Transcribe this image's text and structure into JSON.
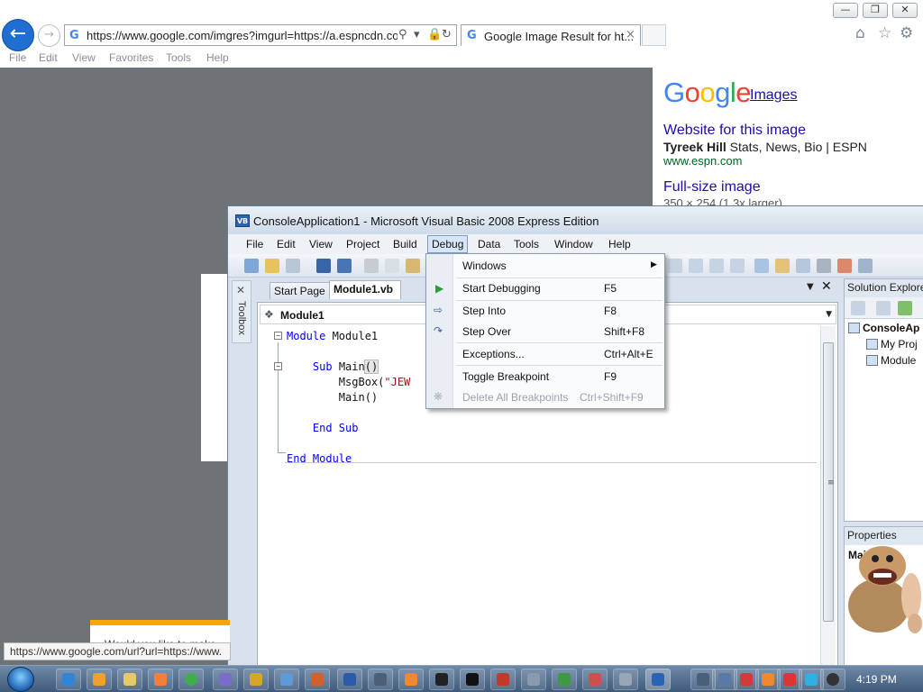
{
  "browser": {
    "address_url": "https://www.google.com/imgres?imgurl=https://a.espncdn.con",
    "tab_title": "Google Image Result for ht...",
    "tab_close": "×",
    "menu": [
      "File",
      "Edit",
      "View",
      "Favorites",
      "Tools",
      "Help"
    ],
    "status_url": "https://www.google.com/url?url=https://www.",
    "window_controls": {
      "minimize": "—",
      "restore": "❐",
      "close": "✕"
    }
  },
  "page": {
    "logo_text": "Google",
    "images_link": "Images",
    "website_heading": "Website for this image",
    "site_title_bold": "Tyreek Hill",
    "site_title_rest": " Stats, News, Bio | ESPN",
    "site_domain": "www.espn.com",
    "fullsize_heading": "Full-size image",
    "fullsize_dims": "350 × 254 (1.3x larger)",
    "popup_text": "Would you like to make"
  },
  "vb": {
    "logo": "VB",
    "title": "ConsoleApplication1 - Microsoft Visual Basic 2008 Express Edition",
    "menus": [
      "File",
      "Edit",
      "View",
      "Project",
      "Build",
      "Debug",
      "Data",
      "Tools",
      "Window",
      "Help"
    ],
    "toolbox_label": "Toolbox",
    "tabs": {
      "start": "Start Page",
      "module": "Module1.vb"
    },
    "nav_combo": "Module1",
    "code": {
      "l1_kw": "Module",
      "l1_name": " Module1",
      "l2_kw": "Sub",
      "l2_name": " Main",
      "l2_parens": "()",
      "l3_call": "MsgBox(",
      "l3_str": "\"JEW",
      "l4": "Main()",
      "l5": "End Sub",
      "l6": "End Module"
    },
    "solution": {
      "title": "Solution Explorer",
      "items": [
        "ConsoleAp",
        "My Proj",
        "Module"
      ]
    },
    "properties": {
      "title": "Properties",
      "object": "Main utes"
    }
  },
  "debug_menu": {
    "items": [
      {
        "label": "Windows",
        "shortcut": ""
      },
      {
        "label": "Start Debugging",
        "shortcut": "F5"
      },
      {
        "label": "Step Into",
        "shortcut": "F8"
      },
      {
        "label": "Step Over",
        "shortcut": "Shift+F8"
      },
      {
        "label": "Exceptions...",
        "shortcut": "Ctrl+Alt+E"
      },
      {
        "label": "Toggle Breakpoint",
        "shortcut": "F9"
      },
      {
        "label": "Delete All Breakpoints",
        "shortcut": "Ctrl+Shift+F9"
      }
    ]
  },
  "taskbar": {
    "time": "4:19 PM"
  },
  "colors": {
    "accent": "#1f6fd1",
    "keyword": "#0000ff",
    "string": "#a31515",
    "link": "#1a0dab",
    "url_green": "#006621"
  },
  "icons": {
    "back": "back-arrow-icon",
    "forward": "forward-arrow-icon",
    "home": "home-icon",
    "favorites": "star-icon",
    "settings": "gear-icon"
  }
}
